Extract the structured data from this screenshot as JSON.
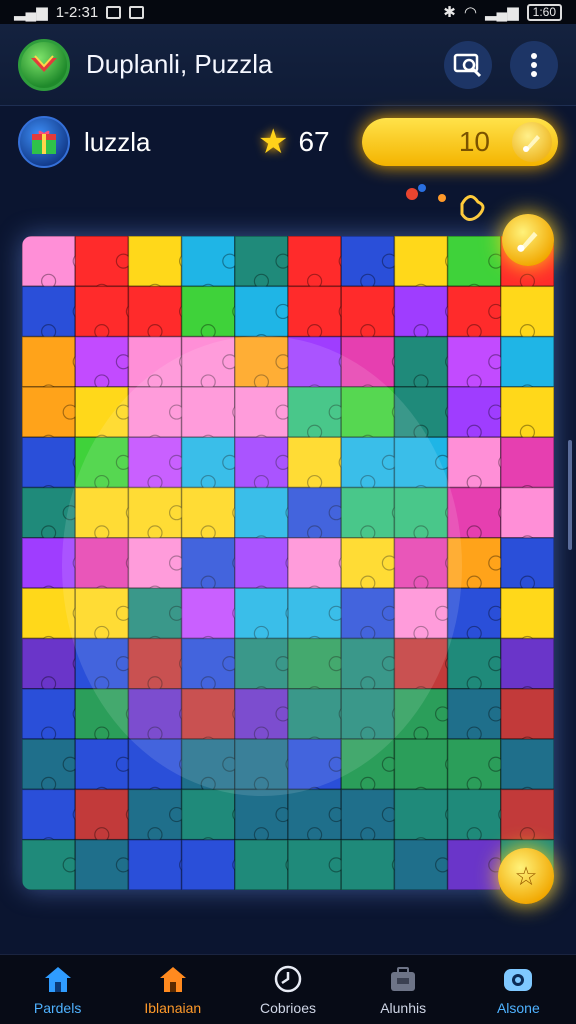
{
  "status_bar": {
    "time": "1-2:31",
    "battery_text": "1:60"
  },
  "app_bar": {
    "title": "Duplanli, Puzzla",
    "logo_icon": "puzzle-logo-icon",
    "search_icon": "search-screen-icon",
    "menu_icon": "more-vertical-icon"
  },
  "player": {
    "name": "luzzla",
    "stars": "67",
    "coins": "10"
  },
  "board": {
    "rows": 13,
    "cols": 10,
    "colors": [
      "#ffd81a",
      "#3fd23a",
      "#ff2b2b",
      "#c24bff",
      "#1fb5e6",
      "#ff8fd7",
      "#2a4fd9",
      "#1f8a7a",
      "#ffa31a",
      "#9f3dff",
      "#30c07a",
      "#e63fb0"
    ]
  },
  "colors": {
    "accent": "#ffc515",
    "nav_active_orange": "#ff9a2a",
    "nav_active_blue": "#4fb2ff",
    "background": "#0b1530"
  },
  "nav": {
    "items": [
      {
        "label": "Pardels",
        "icon": "home-icon"
      },
      {
        "label": "Iblanaian",
        "icon": "home-orange-icon"
      },
      {
        "label": "Cobrioes",
        "icon": "clock-icon"
      },
      {
        "label": "Alunhis",
        "icon": "toolbox-icon"
      },
      {
        "label": "Alsone",
        "icon": "camera-icon"
      }
    ]
  }
}
